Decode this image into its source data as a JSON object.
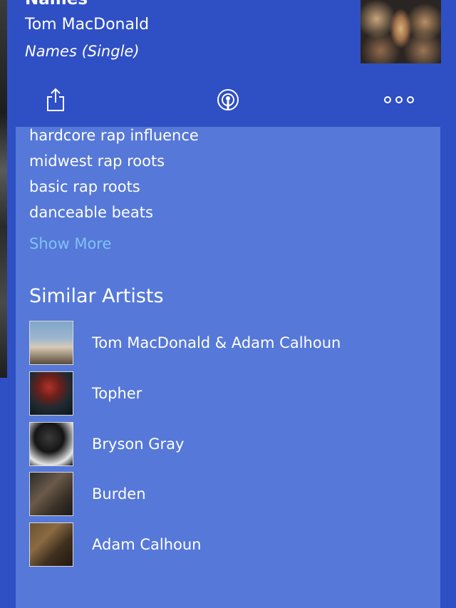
{
  "now_playing": {
    "title": "Names",
    "artist": "Tom MacDonald",
    "album": "Names (Single)"
  },
  "toolbar": {
    "share_icon": "share-icon",
    "podcast_icon": "podcast-icon",
    "more_icon": "more-icon"
  },
  "tags": [
    "hardcore rap influence",
    "midwest rap roots",
    "basic rap roots",
    "danceable beats"
  ],
  "show_more_label": "Show More",
  "similar_artists": {
    "title": "Similar Artists",
    "items": [
      {
        "name": "Tom MacDonald & Adam Calhoun"
      },
      {
        "name": "Topher"
      },
      {
        "name": "Bryson Gray"
      },
      {
        "name": "Burden"
      },
      {
        "name": "Adam Calhoun"
      }
    ]
  },
  "colors": {
    "header_bg": "#2f4fc4",
    "panel_bg": "#5678d8",
    "link": "#7fc3f5"
  }
}
